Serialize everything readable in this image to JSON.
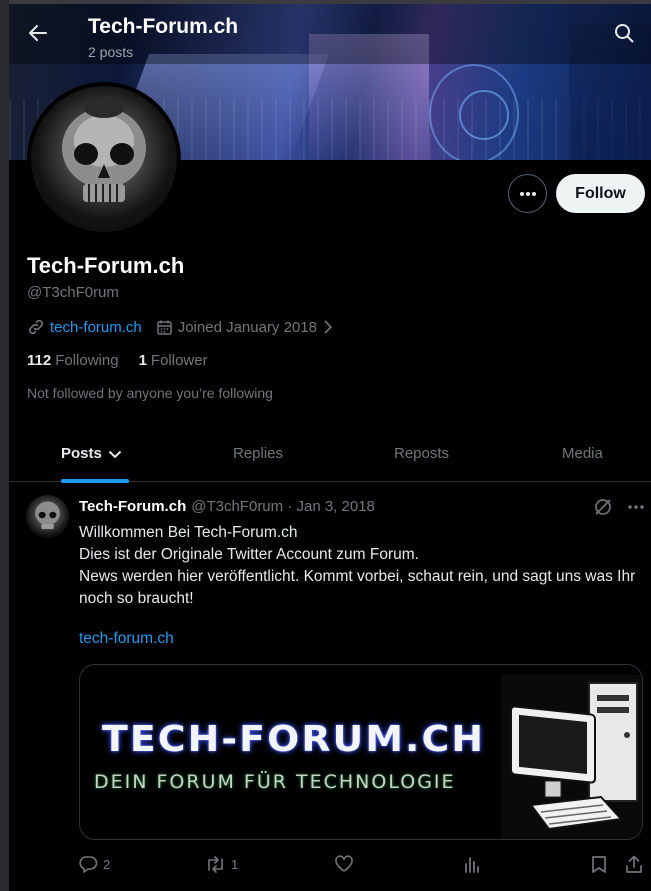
{
  "header": {
    "title": "Tech-Forum.ch",
    "subtitle": "2 posts"
  },
  "profile": {
    "display_name": "Tech-Forum.ch",
    "handle": "@T3chF0rum",
    "website": "tech-forum.ch",
    "joined": "Joined January 2018",
    "following_count": "112",
    "following_label": "Following",
    "followers_count": "1",
    "followers_label": "Follower",
    "not_followed": "Not followed by anyone you’re following",
    "follow_label": "Follow"
  },
  "tabs": [
    {
      "label": "Posts"
    },
    {
      "label": "Replies"
    },
    {
      "label": "Reposts"
    },
    {
      "label": "Media"
    }
  ],
  "post": {
    "name": "Tech-Forum.ch",
    "meta": "@T3chF0rum · Jan 3, 2018",
    "lines": [
      "Willkommen Bei Tech-Forum.ch",
      "Dies ist der Originale Twitter Account zum Forum.",
      "News werden hier veröffentlicht. Kommt vorbei, schaut rein, und sagt uns was Ihr noch so braucht!"
    ],
    "link": "tech-forum.ch",
    "card": {
      "title": "TECH-FORUM.CH",
      "subtitle": "DEIN FORUM FÜR TECHNOLOGIE"
    },
    "replies": "2",
    "reposts": "1"
  },
  "colors": {
    "accent": "#1d9bf0",
    "muted": "#71767b",
    "background": "#000000"
  }
}
